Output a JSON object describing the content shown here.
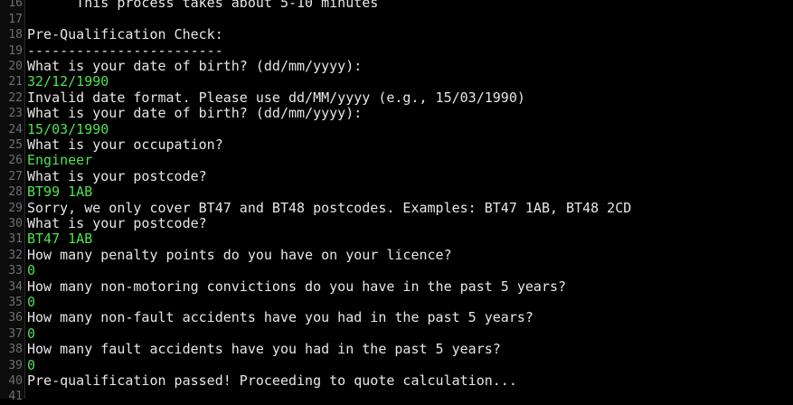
{
  "terminal": {
    "colors": {
      "background": "#000000",
      "output_text": "#e6e6e6",
      "input_text": "#4ee34e",
      "line_number": "#6e6e6e"
    },
    "lines": [
      {
        "n": "16",
        "text": "      This process takes about 5-10 minutes",
        "kind": "out"
      },
      {
        "n": "17",
        "text": "",
        "kind": "out"
      },
      {
        "n": "18",
        "text": "Pre-Qualification Check:",
        "kind": "out"
      },
      {
        "n": "19",
        "text": "------------------------",
        "kind": "sep"
      },
      {
        "n": "20",
        "text": "What is your date of birth? (dd/mm/yyyy):",
        "kind": "out"
      },
      {
        "n": "21",
        "text": "32/12/1990",
        "kind": "in"
      },
      {
        "n": "22",
        "text": "Invalid date format. Please use dd/MM/yyyy (e.g., 15/03/1990)",
        "kind": "out"
      },
      {
        "n": "23",
        "text": "What is your date of birth? (dd/mm/yyyy):",
        "kind": "out"
      },
      {
        "n": "24",
        "text": "15/03/1990",
        "kind": "in"
      },
      {
        "n": "25",
        "text": "What is your occupation?",
        "kind": "out"
      },
      {
        "n": "26",
        "text": "Engineer",
        "kind": "in"
      },
      {
        "n": "27",
        "text": "What is your postcode?",
        "kind": "out"
      },
      {
        "n": "28",
        "text": "BT99 1AB",
        "kind": "in"
      },
      {
        "n": "29",
        "text": "Sorry, we only cover BT47 and BT48 postcodes. Examples: BT47 1AB, BT48 2CD",
        "kind": "out"
      },
      {
        "n": "30",
        "text": "What is your postcode?",
        "kind": "out"
      },
      {
        "n": "31",
        "text": "BT47 1AB",
        "kind": "in"
      },
      {
        "n": "32",
        "text": "How many penalty points do you have on your licence?",
        "kind": "out"
      },
      {
        "n": "33",
        "text": "0",
        "kind": "in"
      },
      {
        "n": "34",
        "text": "How many non-motoring convictions do you have in the past 5 years?",
        "kind": "out"
      },
      {
        "n": "35",
        "text": "0",
        "kind": "in"
      },
      {
        "n": "36",
        "text": "How many non-fault accidents have you had in the past 5 years?",
        "kind": "out"
      },
      {
        "n": "37",
        "text": "0",
        "kind": "in"
      },
      {
        "n": "38",
        "text": "How many fault accidents have you had in the past 5 years?",
        "kind": "out"
      },
      {
        "n": "39",
        "text": "0",
        "kind": "in"
      },
      {
        "n": "40",
        "text": "Pre-qualification passed! Proceeding to quote calculation...",
        "kind": "out"
      },
      {
        "n": "41",
        "text": "",
        "kind": "out"
      }
    ]
  }
}
